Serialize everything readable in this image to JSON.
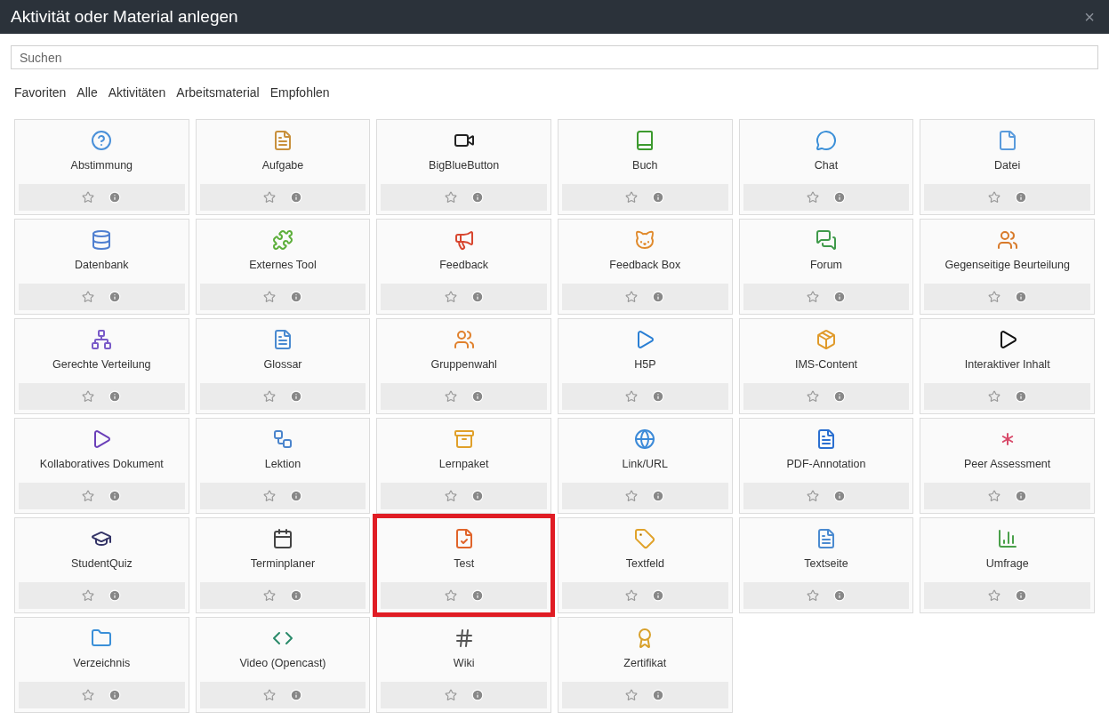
{
  "window": {
    "title": "Aktivität oder Material anlegen",
    "close": "×"
  },
  "search": {
    "placeholder": "Suchen"
  },
  "tabs": [
    {
      "label": "Favoriten",
      "selected": false
    },
    {
      "label": "Alle",
      "selected": false
    },
    {
      "label": "Aktivitäten",
      "selected": false
    },
    {
      "label": "Arbeitsmaterial",
      "selected": false
    },
    {
      "label": "Empfohlen",
      "selected": false
    }
  ],
  "items": [
    {
      "label": "Abstimmung",
      "highlighted": false
    },
    {
      "label": "Aufgabe",
      "highlighted": false
    },
    {
      "label": "BigBlueButton",
      "highlighted": false
    },
    {
      "label": "Buch",
      "highlighted": false
    },
    {
      "label": "Chat",
      "highlighted": false
    },
    {
      "label": "Datei",
      "highlighted": false
    },
    {
      "label": "Datenbank",
      "highlighted": false
    },
    {
      "label": "Externes Tool",
      "highlighted": false
    },
    {
      "label": "Feedback",
      "highlighted": false
    },
    {
      "label": "Feedback Box",
      "highlighted": false
    },
    {
      "label": "Forum",
      "highlighted": false
    },
    {
      "label": "Gegenseitige Beurteilung",
      "highlighted": false
    },
    {
      "label": "Gerechte Verteilung",
      "highlighted": false
    },
    {
      "label": "Glossar",
      "highlighted": false
    },
    {
      "label": "Gruppenwahl",
      "highlighted": false
    },
    {
      "label": "H5P",
      "highlighted": false
    },
    {
      "label": "IMS-Content",
      "highlighted": false
    },
    {
      "label": "Interaktiver Inhalt",
      "highlighted": false
    },
    {
      "label": "Kollaboratives Dokument",
      "highlighted": false
    },
    {
      "label": "Lektion",
      "highlighted": false
    },
    {
      "label": "Lernpaket",
      "highlighted": false
    },
    {
      "label": "Link/URL",
      "highlighted": false
    },
    {
      "label": "PDF-Annotation",
      "highlighted": false
    },
    {
      "label": "Peer Assessment",
      "highlighted": false
    },
    {
      "label": "StudentQuiz",
      "highlighted": false
    },
    {
      "label": "Terminplaner",
      "highlighted": false
    },
    {
      "label": "Test",
      "highlighted": true
    },
    {
      "label": "Textfeld",
      "highlighted": false
    },
    {
      "label": "Textseite",
      "highlighted": false
    },
    {
      "label": "Umfrage",
      "highlighted": false
    },
    {
      "label": "Verzeichnis",
      "highlighted": false
    },
    {
      "label": "Video (Opencast)",
      "highlighted": false
    },
    {
      "label": "Wiki",
      "highlighted": false
    },
    {
      "label": "Zertifikat",
      "highlighted": false
    }
  ]
}
